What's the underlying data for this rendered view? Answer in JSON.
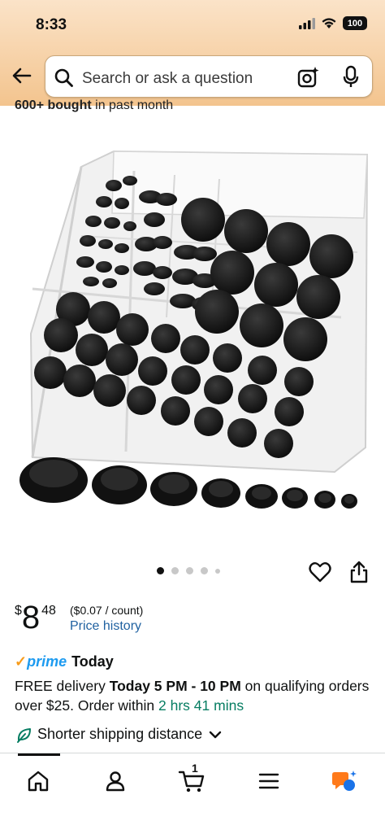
{
  "status_bar": {
    "time": "8:33",
    "battery": "100"
  },
  "search": {
    "placeholder": "Search or ask a question"
  },
  "product": {
    "bought_bold": "600+ bought",
    "bought_rest": " in past month",
    "image_count": 5,
    "active_image": 1
  },
  "price": {
    "symbol": "$",
    "whole": "8",
    "fraction": "48",
    "unit_price": "($0.07 / count)",
    "history_link": "Price history"
  },
  "prime": {
    "logo": "prime",
    "today": "Today"
  },
  "delivery": {
    "prefix": "FREE delivery ",
    "window": "Today 5 PM - 10 PM",
    "middle": " on qualifying orders over $25. Order within ",
    "countdown": "2 hrs 41 mins"
  },
  "shipping": {
    "label": "Shorter shipping distance"
  },
  "bottom_nav": {
    "items": [
      "home-icon",
      "account-icon",
      "cart-icon",
      "menu-icon",
      "ai-assistant-icon"
    ],
    "cart_count": "1"
  },
  "colors": {
    "header_top": "#fbe3c8",
    "header_bottom": "#f3c48e",
    "link": "#2162a1",
    "green": "#067d62",
    "prime_blue": "#1d9bf0",
    "prime_orange": "#f79c1b"
  }
}
